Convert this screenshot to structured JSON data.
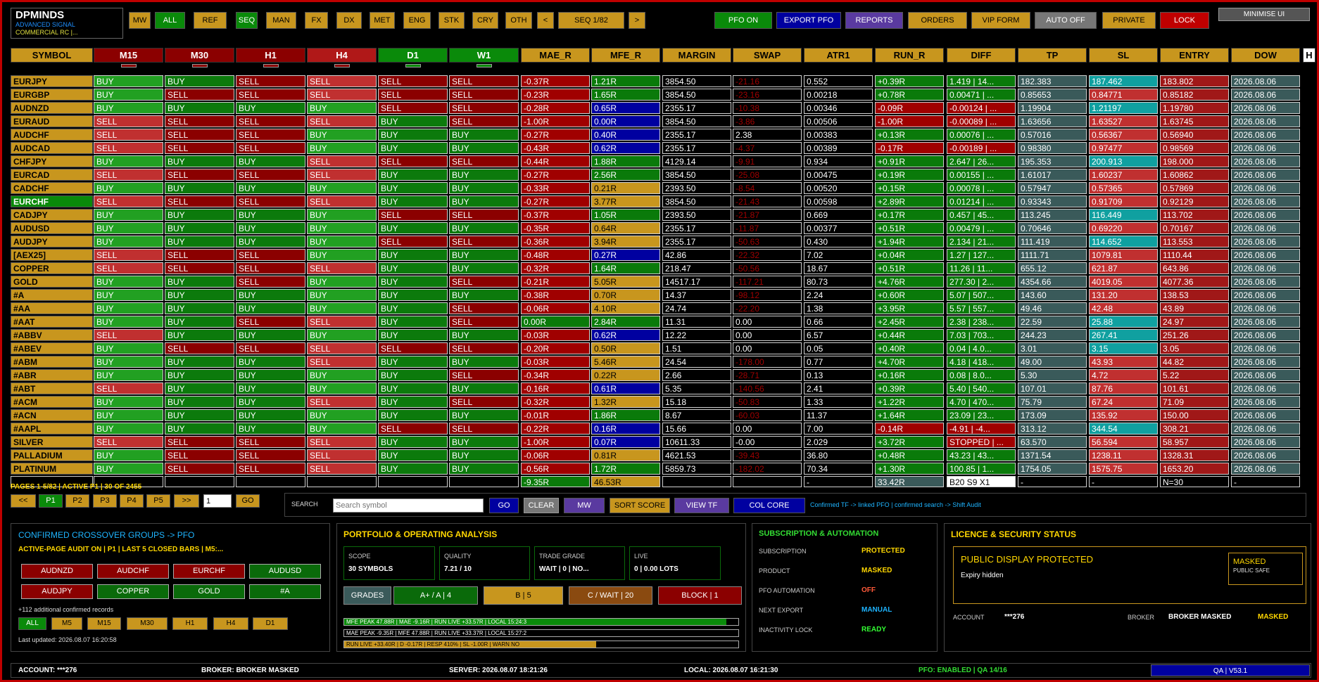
{
  "brand": {
    "title": "DPMINDS",
    "line1": "ADVANCED SIGNAL",
    "line2": "COMMERCIAL RC |..."
  },
  "filters": [
    "MW",
    "ALL",
    "REF",
    "SEQ",
    "MAN",
    "FX",
    "DX",
    "MET",
    "ENG",
    "STK",
    "CRY",
    "OTH"
  ],
  "nav": {
    "prev": "<",
    "seq": "SEQ 1/82",
    "next": ">"
  },
  "top_actions": [
    "PFO ON",
    "EXPORT PFO",
    "REPORTS",
    "ORDERS",
    "VIP FORM",
    "AUTO OFF",
    "PRIVATE",
    "LOCK"
  ],
  "minimise": "MINIMISE UI",
  "columns": [
    "SYMBOL",
    "M15",
    "M30",
    "H1",
    "H4",
    "D1",
    "W1",
    "MAE_R",
    "MFE_R",
    "MARGIN",
    "SWAP",
    "ATR1",
    "RUN_R",
    "DIFF",
    "TP",
    "SL",
    "ENTRY",
    "DOW"
  ],
  "overflow_header": "H",
  "rows": [
    [
      "EURJPY",
      "BUY",
      "BUY",
      "SELL",
      "SELL",
      "SELL",
      "SELL",
      "-0.37R",
      "1.21R",
      "3854.50",
      "-21.16",
      "0.552",
      "+0.39R",
      "1.419 | 14...",
      "182.383",
      "187.462",
      "183.802",
      "2026.08.06"
    ],
    [
      "EURGBP",
      "BUY",
      "SELL",
      "SELL",
      "SELL",
      "SELL",
      "SELL",
      "-0.23R",
      "1.65R",
      "3854.50",
      "-23.16",
      "0.00218",
      "+0.78R",
      "0.00471 | ...",
      "0.85653",
      "0.84771",
      "0.85182",
      "2026.08.06"
    ],
    [
      "AUDNZD",
      "BUY",
      "BUY",
      "BUY",
      "BUY",
      "SELL",
      "SELL",
      "-0.28R",
      "0.65R",
      "2355.17",
      "-10.38",
      "0.00346",
      "-0.09R",
      "-0.00124 | ...",
      "1.19904",
      "1.21197",
      "1.19780",
      "2026.08.06"
    ],
    [
      "EURAUD",
      "SELL",
      "SELL",
      "SELL",
      "SELL",
      "BUY",
      "SELL",
      "-1.00R",
      "0.00R",
      "3854.50",
      "-3.86",
      "0.00506",
      "-1.00R",
      "-0.00089 | ...",
      "1.63656",
      "1.63527",
      "1.63745",
      "2026.08.06"
    ],
    [
      "AUDCHF",
      "SELL",
      "SELL",
      "SELL",
      "BUY",
      "BUY",
      "BUY",
      "-0.27R",
      "0.40R",
      "2355.17",
      "2.38",
      "0.00383",
      "+0.13R",
      "0.00076 | ...",
      "0.57016",
      "0.56367",
      "0.56940",
      "2026.08.06"
    ],
    [
      "AUDCAD",
      "SELL",
      "SELL",
      "SELL",
      "BUY",
      "BUY",
      "BUY",
      "-0.43R",
      "0.62R",
      "2355.17",
      "-4.37",
      "0.00389",
      "-0.17R",
      "-0.00189 | ...",
      "0.98380",
      "0.97477",
      "0.98569",
      "2026.08.06"
    ],
    [
      "CHFJPY",
      "BUY",
      "BUY",
      "BUY",
      "SELL",
      "SELL",
      "SELL",
      "-0.44R",
      "1.88R",
      "4129.14",
      "-9.91",
      "0.934",
      "+0.91R",
      "2.647 | 26...",
      "195.353",
      "200.913",
      "198.000",
      "2026.08.06"
    ],
    [
      "EURCAD",
      "SELL",
      "SELL",
      "SELL",
      "SELL",
      "BUY",
      "BUY",
      "-0.27R",
      "2.56R",
      "3854.50",
      "-25.08",
      "0.00475",
      "+0.19R",
      "0.00155 | ...",
      "1.61017",
      "1.60237",
      "1.60862",
      "2026.08.06"
    ],
    [
      "CADCHF",
      "BUY",
      "BUY",
      "BUY",
      "BUY",
      "BUY",
      "BUY",
      "-0.33R",
      "0.21R",
      "2393.50",
      "-8.54",
      "0.00520",
      "+0.15R",
      "0.00078 | ...",
      "0.57947",
      "0.57365",
      "0.57869",
      "2026.08.06"
    ],
    [
      "EURCHF",
      "SELL",
      "SELL",
      "SELL",
      "SELL",
      "BUY",
      "BUY",
      "-0.27R",
      "3.77R",
      "3854.50",
      "-21.43",
      "0.00598",
      "+2.89R",
      "0.01214 | ...",
      "0.93343",
      "0.91709",
      "0.92129",
      "2026.08.06"
    ],
    [
      "CADJPY",
      "BUY",
      "BUY",
      "BUY",
      "BUY",
      "SELL",
      "SELL",
      "-0.37R",
      "1.05R",
      "2393.50",
      "-21.87",
      "0.669",
      "+0.17R",
      "0.457 | 45...",
      "113.245",
      "116.449",
      "113.702",
      "2026.08.06"
    ],
    [
      "AUDUSD",
      "BUY",
      "BUY",
      "BUY",
      "BUY",
      "BUY",
      "BUY",
      "-0.35R",
      "0.64R",
      "2355.17",
      "-11.87",
      "0.00377",
      "+0.51R",
      "0.00479 | ...",
      "0.70646",
      "0.69220",
      "0.70167",
      "2026.08.06"
    ],
    [
      "AUDJPY",
      "BUY",
      "BUY",
      "BUY",
      "BUY",
      "SELL",
      "SELL",
      "-0.36R",
      "3.94R",
      "2355.17",
      "-50.63",
      "0.430",
      "+1.94R",
      "2.134 | 21...",
      "111.419",
      "114.652",
      "113.553",
      "2026.08.06"
    ],
    [
      "[AEX25]",
      "SELL",
      "SELL",
      "SELL",
      "BUY",
      "BUY",
      "BUY",
      "-0.48R",
      "0.27R",
      "42.86",
      "-22.32",
      "7.02",
      "+0.04R",
      "1.27 | 127...",
      "1111.71",
      "1079.81",
      "1110.44",
      "2026.08.06"
    ],
    [
      "COPPER",
      "SELL",
      "SELL",
      "SELL",
      "SELL",
      "BUY",
      "BUY",
      "-0.32R",
      "1.64R",
      "218.47",
      "-50.56",
      "18.67",
      "+0.51R",
      "11.26 | 11...",
      "655.12",
      "621.87",
      "643.86",
      "2026.08.06"
    ],
    [
      "GOLD",
      "BUY",
      "BUY",
      "SELL",
      "BUY",
      "BUY",
      "SELL",
      "-0.21R",
      "5.05R",
      "14517.17",
      "-117.21",
      "80.73",
      "+4.76R",
      "277.30 | 2...",
      "4354.66",
      "4019.05",
      "4077.36",
      "2026.08.06"
    ],
    [
      "#A",
      "BUY",
      "BUY",
      "BUY",
      "BUY",
      "BUY",
      "BUY",
      "-0.38R",
      "0.70R",
      "14.37",
      "-98.12",
      "2.24",
      "+0.60R",
      "5.07 | 507...",
      "143.60",
      "131.20",
      "138.53",
      "2026.08.06"
    ],
    [
      "#AA",
      "BUY",
      "BUY",
      "BUY",
      "BUY",
      "BUY",
      "SELL",
      "-0.06R",
      "4.10R",
      "24.74",
      "-22.20",
      "1.38",
      "+3.95R",
      "5.57 | 557...",
      "49.46",
      "42.48",
      "43.89",
      "2026.08.06"
    ],
    [
      "#AAT",
      "BUY",
      "BUY",
      "SELL",
      "SELL",
      "BUY",
      "SELL",
      "0.00R",
      "2.84R",
      "11.31",
      "0.00",
      "0.66",
      "+2.45R",
      "2.38 | 238...",
      "22.59",
      "25.88",
      "24.97",
      "2026.08.06"
    ],
    [
      "#ABBV",
      "SELL",
      "BUY",
      "BUY",
      "BUY",
      "BUY",
      "BUY",
      "-0.03R",
      "0.62R",
      "12.22",
      "0.00",
      "6.57",
      "+0.44R",
      "7.03 | 703...",
      "244.23",
      "267.41",
      "251.26",
      "2026.08.06"
    ],
    [
      "#ABEV",
      "BUY",
      "SELL",
      "SELL",
      "SELL",
      "SELL",
      "SELL",
      "-0.20R",
      "0.50R",
      "1.51",
      "0.00",
      "0.05",
      "+0.40R",
      "0.04 | 4.0...",
      "3.01",
      "3.15",
      "3.05",
      "2026.08.06"
    ],
    [
      "#ABM",
      "BUY",
      "BUY",
      "BUY",
      "SELL",
      "BUY",
      "BUY",
      "-0.03R",
      "5.46R",
      "24.54",
      "-178.00",
      "0.77",
      "+4.70R",
      "4.18 | 418...",
      "49.00",
      "43.93",
      "44.82",
      "2026.08.06"
    ],
    [
      "#ABR",
      "BUY",
      "BUY",
      "BUY",
      "BUY",
      "BUY",
      "SELL",
      "-0.34R",
      "0.22R",
      "2.66",
      "-28.71",
      "0.13",
      "+0.16R",
      "0.08 | 8.0...",
      "5.30",
      "4.72",
      "5.22",
      "2026.08.06"
    ],
    [
      "#ABT",
      "SELL",
      "BUY",
      "BUY",
      "BUY",
      "BUY",
      "BUY",
      "-0.16R",
      "0.61R",
      "5.35",
      "-140.56",
      "2.41",
      "+0.39R",
      "5.40 | 540...",
      "107.01",
      "87.76",
      "101.61",
      "2026.08.06"
    ],
    [
      "#ACM",
      "BUY",
      "BUY",
      "BUY",
      "SELL",
      "BUY",
      "SELL",
      "-0.32R",
      "1.32R",
      "15.18",
      "-50.83",
      "1.33",
      "+1.22R",
      "4.70 | 470...",
      "75.79",
      "67.24",
      "71.09",
      "2026.08.06"
    ],
    [
      "#ACN",
      "BUY",
      "BUY",
      "BUY",
      "BUY",
      "BUY",
      "BUY",
      "-0.01R",
      "1.86R",
      "8.67",
      "-60.03",
      "11.37",
      "+1.64R",
      "23.09 | 23...",
      "173.09",
      "135.92",
      "150.00",
      "2026.08.06"
    ],
    [
      "#AAPL",
      "BUY",
      "BUY",
      "BUY",
      "BUY",
      "SELL",
      "SELL",
      "-0.22R",
      "0.16R",
      "15.66",
      "0.00",
      "7.00",
      "-0.14R",
      "-4.91 | -4...",
      "313.12",
      "344.54",
      "308.21",
      "2026.08.06"
    ],
    [
      "SILVER",
      "SELL",
      "SELL",
      "SELL",
      "SELL",
      "BUY",
      "BUY",
      "-1.00R",
      "0.07R",
      "10611.33",
      "-0.00",
      "2.029",
      "+3.72R",
      "STOPPED | ...",
      "63.570",
      "56.594",
      "58.957",
      "2026.08.06"
    ],
    [
      "PALLADIUM",
      "BUY",
      "SELL",
      "SELL",
      "SELL",
      "BUY",
      "BUY",
      "-0.06R",
      "0.81R",
      "4621.53",
      "-39.43",
      "36.80",
      "+0.48R",
      "43.23 | 43...",
      "1371.54",
      "1238.11",
      "1328.31",
      "2026.08.06"
    ],
    [
      "PLATINUM",
      "BUY",
      "SELL",
      "SELL",
      "SELL",
      "BUY",
      "BUY",
      "-0.56R",
      "1.72R",
      "5859.73",
      "-182.02",
      "70.34",
      "+1.30R",
      "100.85 | 1...",
      "1754.05",
      "1575.75",
      "1653.20",
      "2026.08.06"
    ]
  ],
  "totals": [
    "",
    "",
    "",
    "",
    "",
    "",
    "",
    "-9.35R",
    "46.53R",
    "",
    "",
    "-",
    "33.42R",
    "B20 S9 X1",
    "-",
    "-",
    "N=30",
    "-"
  ],
  "pages": {
    "summary": "PAGES 1-5/82 | ACTIVE P1 | 30 OF 2455",
    "buttons": [
      "<<",
      "P1",
      "P2",
      "P3",
      "P4",
      "P5",
      ">>"
    ],
    "input": "1",
    "go": "GO"
  },
  "search": {
    "label": "SEARCH",
    "placeholder": "Search symbol",
    "go": "GO",
    "clear": "CLEAR",
    "mw": "MW",
    "sort": "SORT SCORE",
    "view": "VIEW TF",
    "col": "COL CORE",
    "hint": "Confirmed TF -> linked PFO | confirmed search -> Shift Audit"
  },
  "crossover": {
    "title": "CONFIRMED CROSSOVER GROUPS -> PFO",
    "subtitle": "ACTIVE-PAGE AUDIT ON | P1 | LAST 5 CLOSED BARS | M5:...",
    "chips": [
      "AUDNZD",
      "AUDCHF",
      "EURCHF",
      "AUDUSD",
      "AUDJPY",
      "COPPER",
      "GOLD",
      "#A"
    ],
    "more": "+112 additional confirmed records",
    "tfs": [
      "ALL",
      "M5",
      "M15",
      "M30",
      "H1",
      "H4",
      "D1"
    ],
    "updated": "Last updated: 2026.08.07 16:20:58"
  },
  "portfolio": {
    "title": "PORTFOLIO & OPERATING ANALYSIS",
    "boxes": [
      {
        "label": "SCOPE",
        "value": "30 SYMBOLS"
      },
      {
        "label": "QUALITY",
        "value": "7.21 / 10"
      },
      {
        "label": "TRADE GRADE",
        "value": "WAIT | 0 | NO..."
      },
      {
        "label": "LIVE",
        "value": "0 | 0.00 LOTS"
      }
    ],
    "grades": [
      "GRADES",
      "A+ / A | 4",
      "B | 5",
      "C / WAIT | 20",
      "BLOCK | 1"
    ],
    "bars": [
      {
        "text": "MFE PEAK 47.88R | MAE -9.16R | RUN LIVE +33.57R | LOCAL 15:24:3",
        "fill": 0.97,
        "color": "#0a8a0a"
      },
      {
        "text": "MAE PEAK -9.35R | MFE 47.88R | RUN LIVE +33.37R | LOCAL 15:27:2",
        "fill": 0.0,
        "color": "#000000"
      },
      {
        "text": "RUN LIVE +33.40R | D -0.17R | RESP 410% | SL -1.00R | WARN NO",
        "fill": 0.64,
        "color": "#c8961e"
      }
    ]
  },
  "subscription": {
    "title": "SUBSCRIPTION & AUTOMATION",
    "items": [
      {
        "label": "SUBSCRIPTION",
        "value": "PROTECTED",
        "color": "#ffd700"
      },
      {
        "label": "PRODUCT",
        "value": "MASKED",
        "color": "#ffd700"
      },
      {
        "label": "PFO AUTOMATION",
        "value": "OFF",
        "color": "#ff5a3a"
      },
      {
        "label": "NEXT EXPORT",
        "value": "MANUAL",
        "color": "#1eb4ff"
      },
      {
        "label": "INACTIVITY LOCK",
        "value": "READY",
        "color": "#33ff33"
      }
    ]
  },
  "licence": {
    "title": "LICENCE & SECURITY STATUS",
    "heading": "PUBLIC DISPLAY PROTECTED",
    "expiry": "Expiry hidden",
    "badge": "MASKED",
    "badge_sub": "PUBLIC SAFE",
    "account_label": "ACCOUNT",
    "account": "***276",
    "broker_label": "BROKER",
    "broker": "BROKER MASKED",
    "broker_status": "MASKED"
  },
  "status": {
    "account": "ACCOUNT: ***276",
    "broker": "BROKER: BROKER MASKED",
    "server": "SERVER: 2026.08.07 18:21:26",
    "local": "LOCAL: 2026.08.07 16:21:30",
    "pfo": "PFO: ENABLED | QA 14/16",
    "qa": "QA | V53.1"
  }
}
